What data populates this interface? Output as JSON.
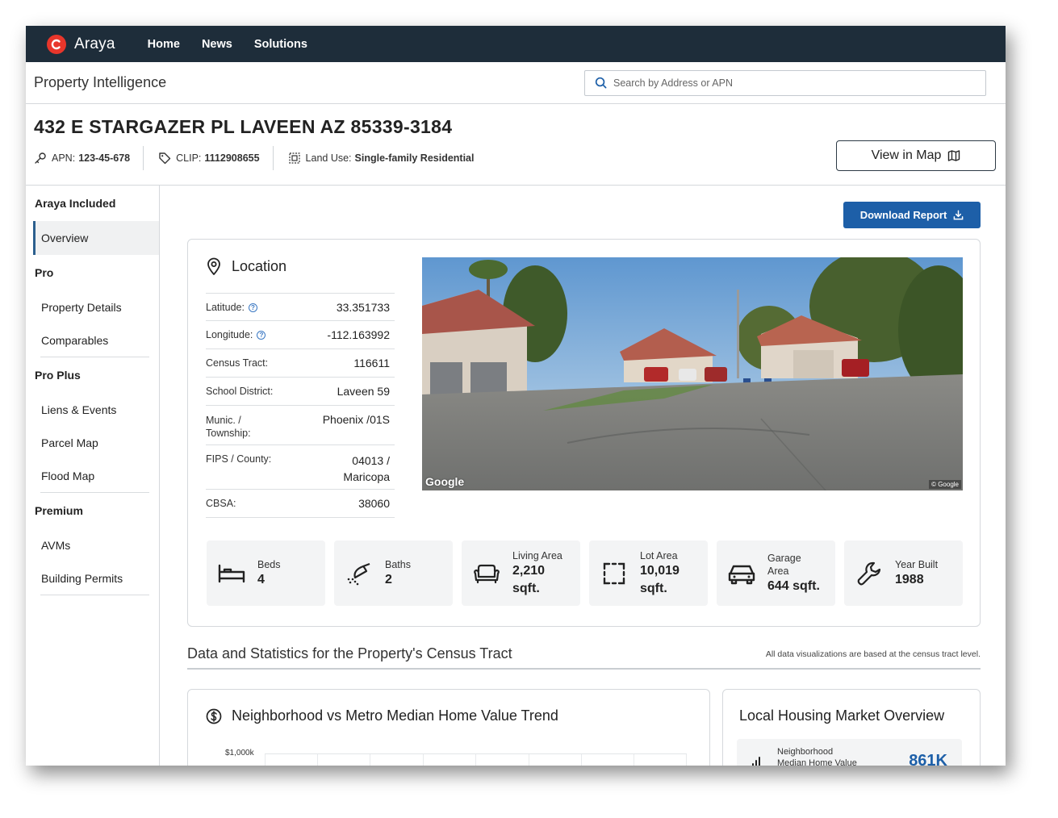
{
  "nav": {
    "brand": "Araya",
    "links": [
      "Home",
      "News",
      "Solutions"
    ]
  },
  "subheader": {
    "title": "Property Intelligence",
    "search_placeholder": "Search by Address or APN"
  },
  "property": {
    "address": "432 E STARGAZER PL LAVEEN AZ 85339-3184",
    "apn_label": "APN:",
    "apn": "123-45-678",
    "clip_label": "CLIP:",
    "clip": "1112908655",
    "land_use_label": "Land Use:",
    "land_use": "Single-family Residential",
    "view_map": "View in Map"
  },
  "sidebar": {
    "groups": [
      {
        "label": "Araya Included",
        "items": [
          "Overview"
        ]
      },
      {
        "label": "Pro",
        "items": [
          "Property Details",
          "Comparables"
        ]
      },
      {
        "label": "Pro Plus",
        "items": [
          "Liens & Events",
          "Parcel Map",
          "Flood Map"
        ]
      },
      {
        "label": "Premium",
        "items": [
          "AVMs",
          "Building Permits"
        ]
      }
    ]
  },
  "main": {
    "download": "Download Report",
    "location": {
      "title": "Location",
      "rows": [
        {
          "k": "Latitude:",
          "v": "33.351733"
        },
        {
          "k": "Longitude:",
          "v": "-112.163992"
        },
        {
          "k": "Census Tract:",
          "v": "116611"
        },
        {
          "k": "School District:",
          "v": "Laveen 59"
        },
        {
          "k1": "Munic. /",
          "k2": "Township:",
          "v": "Phoenix /01S"
        },
        {
          "k": "FIPS / County:",
          "v1": "04013 /",
          "v2": "Maricopa"
        },
        {
          "k": "CBSA:",
          "v": "38060"
        }
      ],
      "photo_brand": "Google",
      "photo_copyright": "© Google"
    },
    "stats": [
      {
        "icon": "bed-icon",
        "l1": "Beds",
        "v1": "4"
      },
      {
        "icon": "shower-icon",
        "l1": "Baths",
        "v1": "2"
      },
      {
        "icon": "sofa-icon",
        "l1": "Living Area",
        "v1": "2,210",
        "v2": "sqft."
      },
      {
        "icon": "lot-area-icon",
        "l1": "Lot Area",
        "v1": "10,019",
        "v2": "sqft."
      },
      {
        "icon": "car-icon",
        "l1": "Garage",
        "l2": "Area",
        "v1": "644 sqft."
      },
      {
        "icon": "wrench-icon",
        "l1": "Year Built",
        "v1": "1988"
      }
    ],
    "section": {
      "title": "Data and Statistics for the Property's Census Tract",
      "note": "All data visualizations are based at the census tract level."
    },
    "trend": {
      "title": "Neighborhood vs Metro Median Home Value Trend",
      "y_top_label": "$1,000k"
    },
    "market": {
      "title": "Local Housing Market Overview",
      "line1": "Neighborhood",
      "line2": "Median Home Value",
      "value": "861K"
    }
  }
}
